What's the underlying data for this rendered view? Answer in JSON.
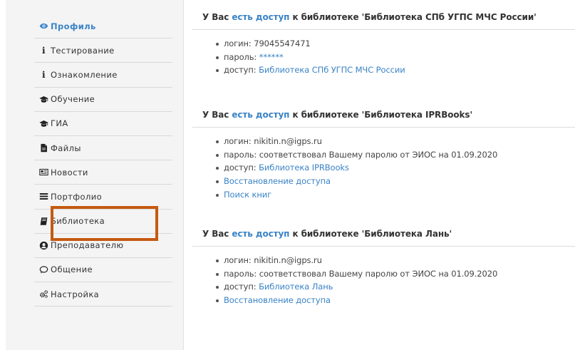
{
  "sidebar": {
    "items": [
      {
        "label": "Профиль",
        "icon": "eye-icon",
        "active": true
      },
      {
        "label": "Тестирование",
        "icon": "info-icon"
      },
      {
        "label": "Ознакомление",
        "icon": "info-icon"
      },
      {
        "label": "Обучение",
        "icon": "graduation-cap-icon"
      },
      {
        "label": "ГИА",
        "icon": "graduation-cap-icon"
      },
      {
        "label": "Файлы",
        "icon": "file-icon"
      },
      {
        "label": "Новости",
        "icon": "newspaper-icon"
      },
      {
        "label": "Портфолио",
        "icon": "list-icon"
      },
      {
        "label": "Библиотека",
        "icon": "book-icon"
      },
      {
        "label": "Преподавателю",
        "icon": "user-circle-icon"
      },
      {
        "label": "Общение",
        "icon": "comment-icon"
      },
      {
        "label": "Настройка",
        "icon": "cogs-icon"
      }
    ],
    "info_glyph": "i",
    "active_color": "#3a83c6",
    "highlight_color": "#c55a11"
  },
  "libraries": [
    {
      "prefix": "У Вас ",
      "access_link": "есть доступ",
      "suffix": " к библиотеке 'Библиотека СПб УГПС МЧС России'",
      "login_text": "логин: 79045547471",
      "password_label": "пароль: ",
      "password_value": "******",
      "access_label": "доступ: ",
      "access_value": "Библиотека СПб УГПС МЧС России"
    },
    {
      "prefix": "У Вас ",
      "access_link": "есть доступ",
      "suffix": " к библиотеке 'Библиотека IPRBooks'",
      "login_text": "логин: nikitin.n@igps.ru",
      "password_text": "пароль: соответствовал Вашему паролю от ЭИОС на 01.09.2020",
      "access_label": "доступ: ",
      "access_value": "Библиотека IPRBooks",
      "restore_link": "Восстановление доступа",
      "search_link": "Поиск книг"
    },
    {
      "prefix": "У Вас ",
      "access_link": "есть доступ",
      "suffix": " к библиотеке 'Библиотека Лань'",
      "login_text": "логин: nikitin.n@igps.ru",
      "password_text": "пароль: соответствовал Вашему паролю от ЭИОС на 01.09.2020",
      "access_label": "доступ: ",
      "access_value": "Библиотека Лань",
      "restore_link": "Восстановление доступа"
    }
  ]
}
